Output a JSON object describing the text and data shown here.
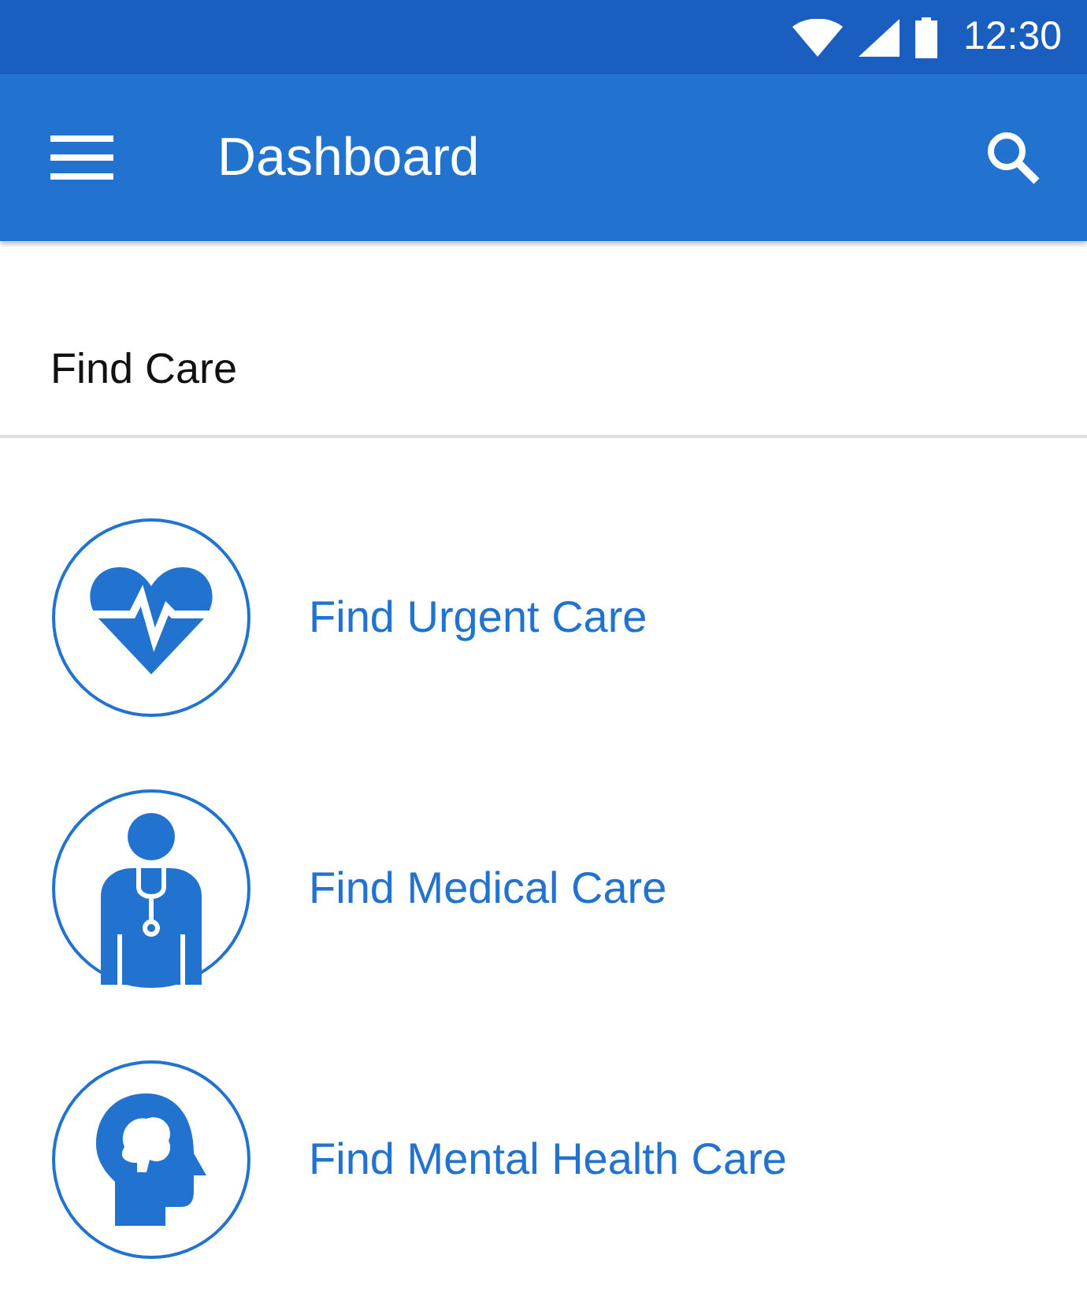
{
  "status_bar": {
    "time": "12:30"
  },
  "app_bar": {
    "title": "Dashboard"
  },
  "section": {
    "title": "Find Care"
  },
  "items": [
    {
      "kind": "heart",
      "label": "Find Urgent Care"
    },
    {
      "kind": "doctor",
      "label": "Find Medical Care"
    },
    {
      "kind": "head",
      "label": "Find Mental Health Care"
    }
  ]
}
